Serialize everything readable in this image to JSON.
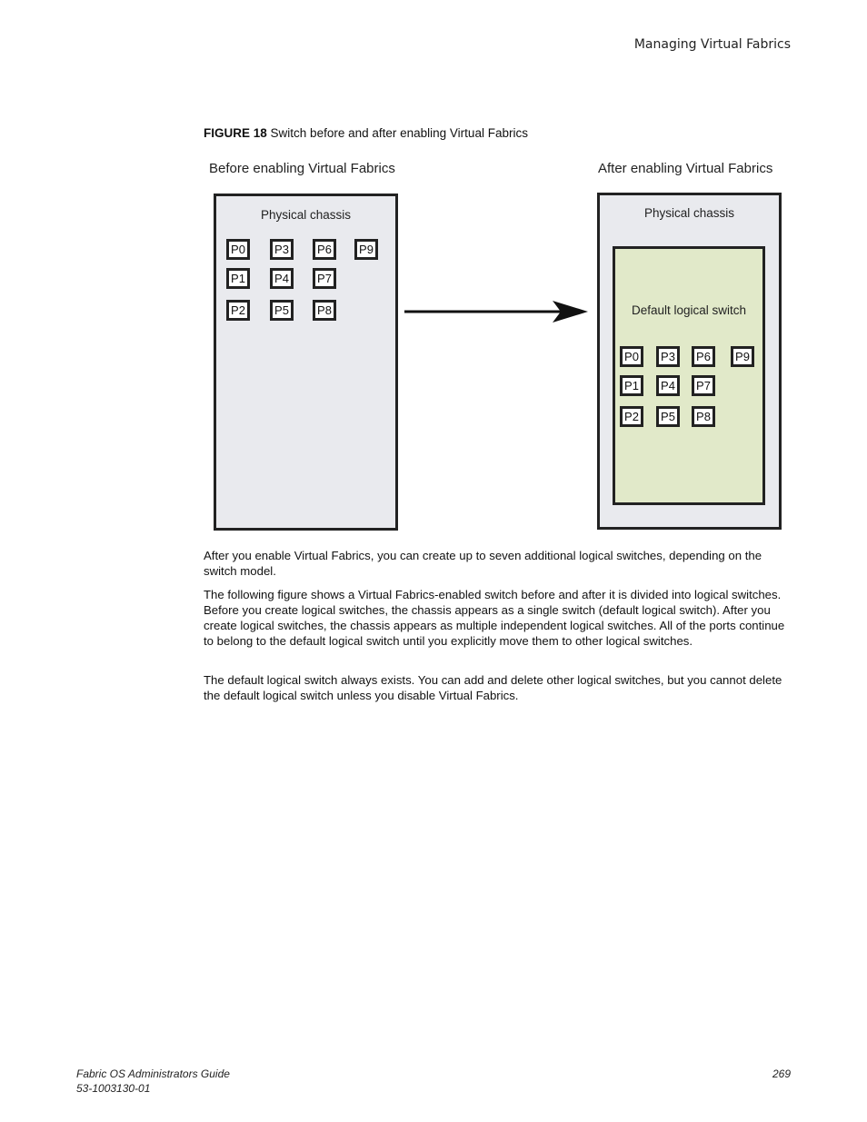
{
  "header": {
    "section_title": "Managing Virtual Fabrics"
  },
  "figure": {
    "label": "FIGURE 18",
    "caption": "Switch before and after enabling Virtual Fabrics",
    "before": {
      "title": "Before enabling Virtual Fabrics",
      "chassis_label": "Physical chassis",
      "ports": [
        "P0",
        "P1",
        "P2",
        "P3",
        "P4",
        "P5",
        "P6",
        "P7",
        "P8",
        "P9"
      ]
    },
    "after": {
      "title": "After enabling Virtual Fabrics",
      "chassis_label": "Physical chassis",
      "logical_switch_label": "Default logical switch",
      "ports": [
        "P0",
        "P1",
        "P2",
        "P3",
        "P4",
        "P5",
        "P6",
        "P7",
        "P8",
        "P9"
      ]
    },
    "colors": {
      "chassis_fill": "#e9eaee",
      "logical_switch_fill": "#e1e9c9",
      "outline": "#222222"
    }
  },
  "body": {
    "paragraphs": [
      "After you enable Virtual Fabrics, you can create up to seven additional logical switches, depending on the switch model.",
      "The following figure shows a Virtual Fabrics-enabled switch before and after it is divided into logical switches. Before you create logical switches, the chassis appears as a single switch (default logical switch). After you create logical switches, the chassis appears as multiple independent logical switches. All of the ports continue to belong to the default logical switch until you explicitly move them to other logical switches.",
      "The default logical switch always exists. You can add and delete other logical switches, but you cannot delete the default logical switch unless you disable Virtual Fabrics."
    ]
  },
  "footer": {
    "doc_title": "Fabric OS Administrators Guide",
    "doc_number": "53-1003130-01",
    "page_number": "269"
  }
}
